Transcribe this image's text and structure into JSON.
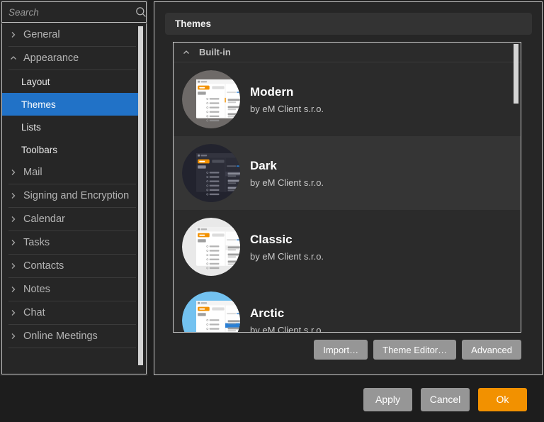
{
  "search": {
    "placeholder": "Search",
    "value": "",
    "icon": "search-icon"
  },
  "sidebar": {
    "items": [
      {
        "label": "General",
        "type": "group",
        "expanded": false,
        "chevron": "chevron-right-icon"
      },
      {
        "label": "Appearance",
        "type": "group",
        "expanded": true,
        "chevron": "chevron-up-icon"
      },
      {
        "label": "Layout",
        "type": "child",
        "selected": false
      },
      {
        "label": "Themes",
        "type": "child",
        "selected": true
      },
      {
        "label": "Lists",
        "type": "child",
        "selected": false
      },
      {
        "label": "Toolbars",
        "type": "child",
        "selected": false
      },
      {
        "label": "Mail",
        "type": "group",
        "expanded": false,
        "chevron": "chevron-right-icon"
      },
      {
        "label": "Signing and Encryption",
        "type": "group",
        "expanded": false,
        "chevron": "chevron-right-icon"
      },
      {
        "label": "Calendar",
        "type": "group",
        "expanded": false,
        "chevron": "chevron-right-icon"
      },
      {
        "label": "Tasks",
        "type": "group",
        "expanded": false,
        "chevron": "chevron-right-icon"
      },
      {
        "label": "Contacts",
        "type": "group",
        "expanded": false,
        "chevron": "chevron-right-icon"
      },
      {
        "label": "Notes",
        "type": "group",
        "expanded": false,
        "chevron": "chevron-right-icon"
      },
      {
        "label": "Chat",
        "type": "group",
        "expanded": false,
        "chevron": "chevron-right-icon"
      },
      {
        "label": "Online Meetings",
        "type": "group",
        "expanded": false,
        "chevron": "chevron-right-icon"
      }
    ]
  },
  "main": {
    "header_title": "Themes",
    "group": {
      "label": "Built-in",
      "expanded": true,
      "chevron": "chevron-up-icon"
    },
    "themes": [
      {
        "name": "Modern",
        "author": "by eM Client s.r.o.",
        "highlighted": false,
        "thumb": "thumb-modern"
      },
      {
        "name": "Dark",
        "author": "by eM Client s.r.o.",
        "highlighted": true,
        "thumb": "thumb-dark"
      },
      {
        "name": "Classic",
        "author": "by eM Client s.r.o.",
        "highlighted": false,
        "thumb": "thumb-classic"
      },
      {
        "name": "Arctic",
        "author": "by eM Client s.r.o.",
        "highlighted": false,
        "thumb": "thumb-arctic"
      }
    ],
    "panel_buttons": [
      {
        "label": "Import…"
      },
      {
        "label": "Theme Editor…"
      },
      {
        "label": "Advanced"
      }
    ]
  },
  "footer": {
    "apply_label": "Apply",
    "cancel_label": "Cancel",
    "ok_label": "Ok"
  },
  "colors": {
    "accent_selection": "#2172c7",
    "accent_ok": "#f29100",
    "dialog_bg": "#1d1d1d",
    "panel_bg": "#262626",
    "row_highlight": "#353535",
    "button_gray": "#969696"
  }
}
